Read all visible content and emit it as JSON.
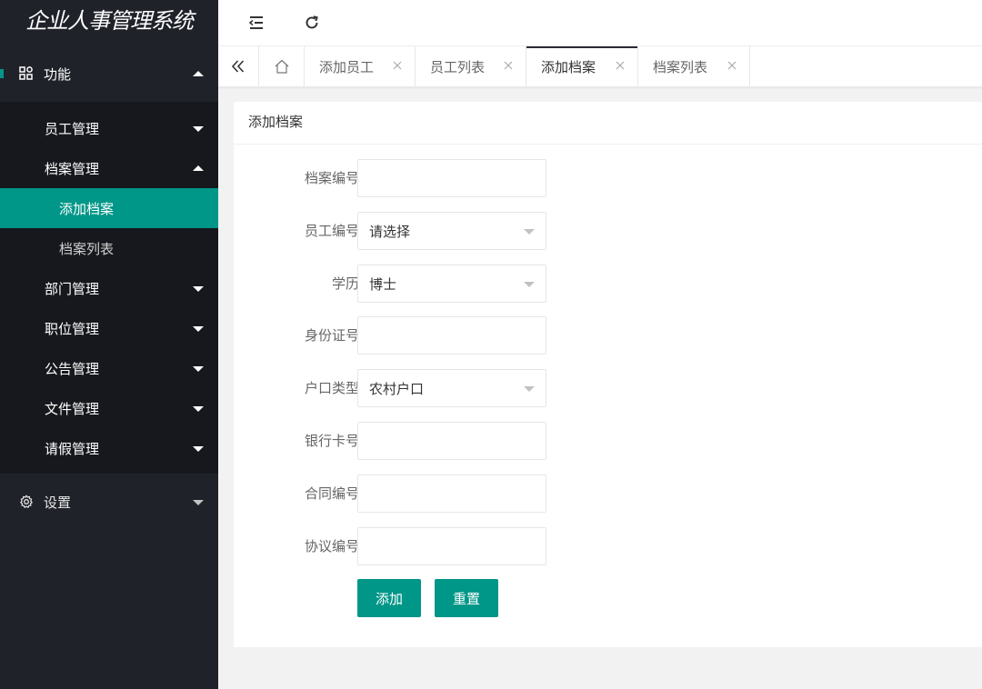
{
  "app": {
    "title": "企业人事管理系统"
  },
  "sidebar": {
    "function_group": {
      "label": "功能",
      "icon": "apps-icon"
    },
    "items": [
      {
        "label": "员工管理",
        "expanded": false
      },
      {
        "label": "档案管理",
        "expanded": true,
        "children": [
          "添加档案",
          "档案列表"
        ]
      },
      {
        "label": "部门管理",
        "expanded": false
      },
      {
        "label": "职位管理",
        "expanded": false
      },
      {
        "label": "公告管理",
        "expanded": false
      },
      {
        "label": "文件管理",
        "expanded": false
      },
      {
        "label": "请假管理",
        "expanded": false
      }
    ],
    "active_child": "添加档案",
    "settings_group": {
      "label": "设置",
      "icon": "gear-icon"
    }
  },
  "topbar": {
    "icons": [
      "collapse-menu-icon",
      "refresh-icon"
    ]
  },
  "tabs": {
    "home_icon": "home-icon",
    "items": [
      {
        "label": "添加员工",
        "active": false
      },
      {
        "label": "员工列表",
        "active": false
      },
      {
        "label": "添加档案",
        "active": true
      },
      {
        "label": "档案列表",
        "active": false
      }
    ]
  },
  "form": {
    "header": "添加档案",
    "fields": [
      {
        "label": "档案编号",
        "type": "input",
        "value": ""
      },
      {
        "label": "员工编号",
        "type": "select",
        "value": "请选择"
      },
      {
        "label": "学历",
        "type": "select",
        "value": "博士"
      },
      {
        "label": "身份证号",
        "type": "input",
        "value": ""
      },
      {
        "label": "户口类型",
        "type": "select",
        "value": "农村户口"
      },
      {
        "label": "银行卡号",
        "type": "input",
        "value": ""
      },
      {
        "label": "合同编号",
        "type": "input",
        "value": ""
      },
      {
        "label": "协议编号",
        "type": "input",
        "value": ""
      }
    ],
    "buttons": {
      "submit": "添加",
      "reset": "重置"
    }
  },
  "colors": {
    "accent": "#009688",
    "sidebar_bg": "#20222a",
    "submenu_bg": "#17181d",
    "page_bg": "#f2f2f2"
  }
}
